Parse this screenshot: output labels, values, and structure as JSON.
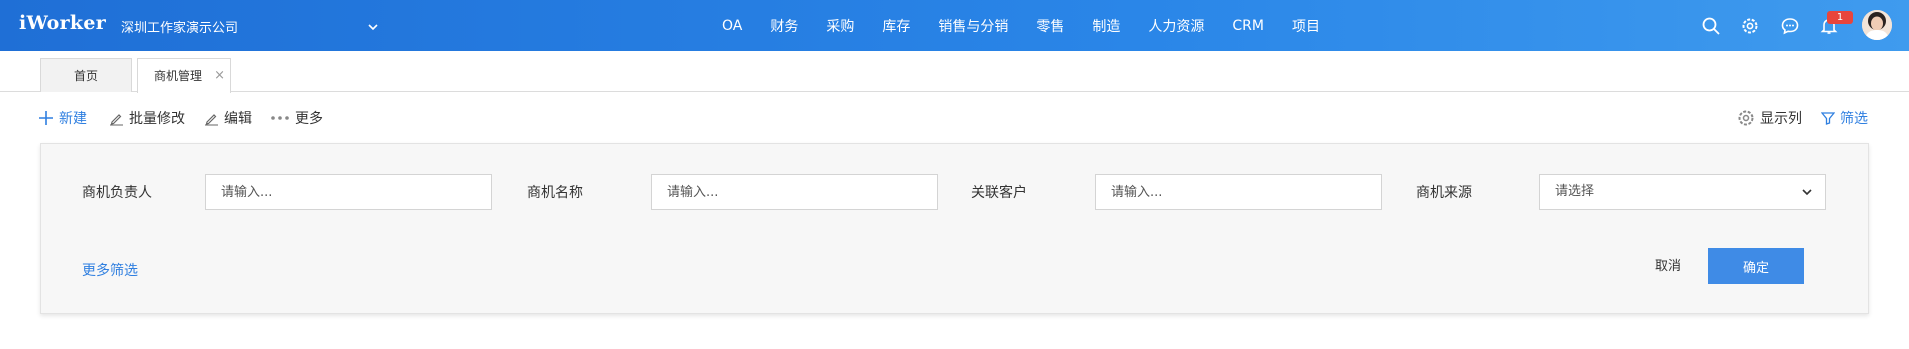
{
  "header": {
    "logo": "iWorker",
    "company": "深圳工作家演示公司",
    "nav": [
      "OA",
      "财务",
      "采购",
      "库存",
      "销售与分销",
      "零售",
      "制造",
      "人力资源",
      "CRM",
      "项目"
    ],
    "notification_count": "1",
    "icons": [
      "search-icon",
      "gear-icon",
      "chat-icon",
      "bell-icon",
      "avatar"
    ]
  },
  "tabs": {
    "home": "首页",
    "active": "商机管理",
    "close": "×"
  },
  "toolbar": {
    "new": "新建",
    "batch_edit": "批量修改",
    "edit": "编辑",
    "more": "更多",
    "columns": "显示列",
    "filter": "筛选"
  },
  "filters": {
    "owner_label": "商机负责人",
    "owner_placeholder": "请输入...",
    "name_label": "商机名称",
    "name_placeholder": "请输入...",
    "customer_label": "关联客户",
    "customer_placeholder": "请输入...",
    "source_label": "商机来源",
    "source_value": "请选择",
    "more_filters": "更多筛选",
    "cancel": "取消",
    "confirm": "确定"
  },
  "colors": {
    "header_start": "#1f6fd6",
    "header_end": "#3f9bee",
    "accent": "#2f7fe0",
    "confirm_bg": "#3f8be6",
    "badge": "#e8453c"
  }
}
